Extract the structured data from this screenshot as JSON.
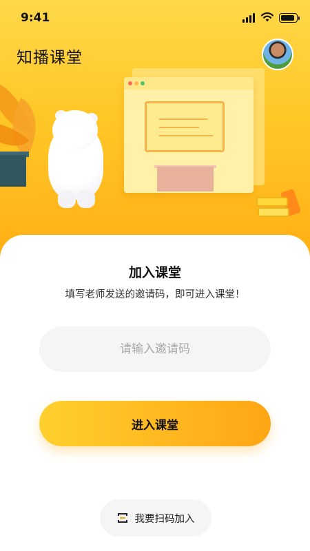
{
  "status_bar": {
    "time": "9:41"
  },
  "header": {
    "app_title": "知播课堂"
  },
  "join_card": {
    "title": "加入课堂",
    "subtitle": "填写老师发送的邀请码，即可进入课堂！",
    "code_input": {
      "value": "",
      "placeholder": "请输入邀请码"
    },
    "enter_button_label": "进入课堂",
    "scan_button_label": "我要扫码加入"
  },
  "colors": {
    "accent_start": "#FFD02E",
    "accent_end": "#FFA514",
    "hero_background": "#FFC726"
  },
  "icons": [
    "signal-icon",
    "wifi-icon",
    "battery-icon",
    "avatar",
    "scan-icon"
  ]
}
